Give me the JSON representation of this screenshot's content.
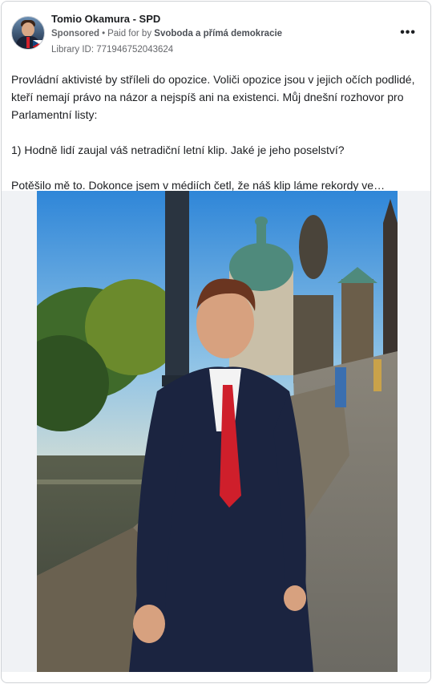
{
  "post": {
    "page_name": "Tomio Okamura - SPD",
    "sponsored": "Sponsored",
    "paid_for_prefix": "Paid for by",
    "payer": "Svoboda a přímá demokracie",
    "library_id": "Library ID: 771946752043624",
    "more_icon": "more-horizontal-icon"
  },
  "body": {
    "para1": "Provládní aktivisté by stříleli do opozice. Voliči opozice jsou v jejich očích podlidé, kteří nemají právo na názor a nejspíš ani na existenci. Můj dnešní rozhovor pro Parlamentní listy:",
    "para2": "1) Hodně lidí zaujal váš netradiční letní klip. Jaké je jeho poselství?",
    "para3": "Potěšilo mě to. Dokonce jsem v médiích četl, že náš klip láme rekordy ve…"
  },
  "colors": {
    "text": "#1c1e21",
    "secondary": "#65676b",
    "tie": "#d4202b"
  }
}
